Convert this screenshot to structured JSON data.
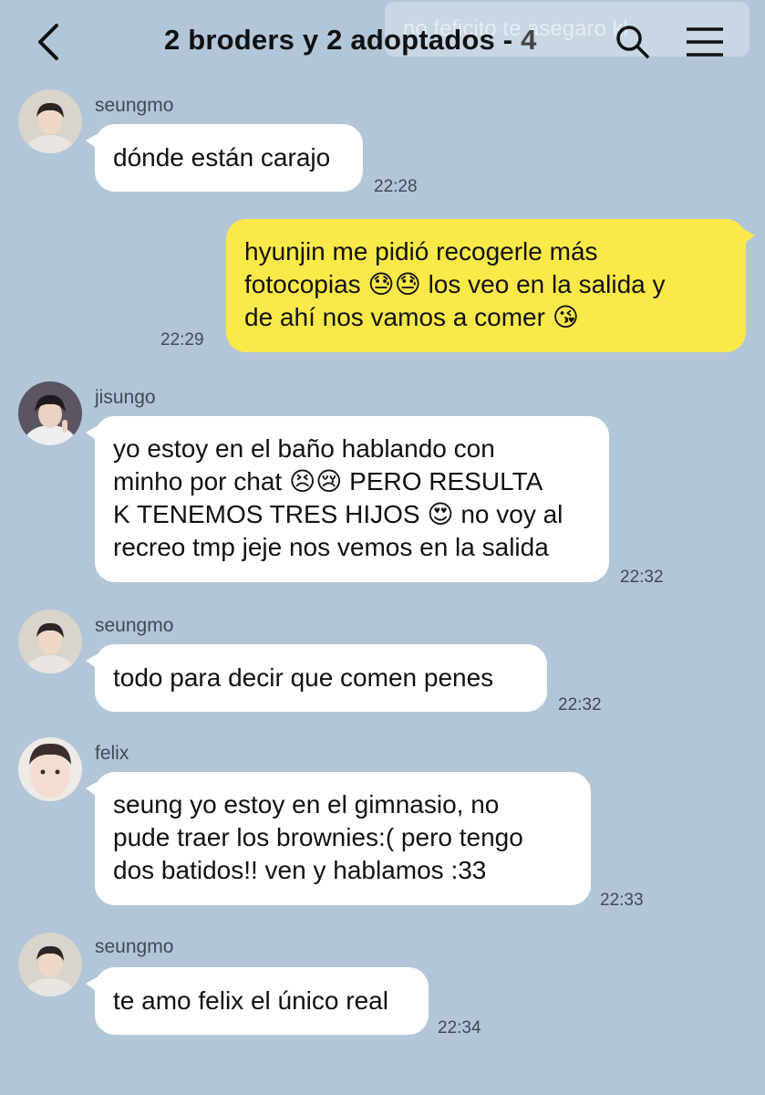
{
  "header": {
    "title": "2 broders y 2 adoptados - ",
    "member_count": "4",
    "ghost_text": "no feficito te asegaro kl",
    "icons": {
      "back": "back-arrow-icon",
      "search": "search-icon",
      "menu": "hamburger-menu-icon"
    }
  },
  "colors": {
    "background": "#b2c6d8",
    "incoming_bubble": "#ffffff",
    "outgoing_bubble": "#fbe94a"
  },
  "messages": [
    {
      "sender": "seungmo",
      "text": "dónde están carajo",
      "time": "22:28",
      "direction": "in"
    },
    {
      "sender": "",
      "text": "hyunjin me pidió recogerle más\nfotocopias 😓😓 los veo en la salida y\nde ahí nos vamos a comer 😘",
      "time": "22:29",
      "direction": "out"
    },
    {
      "sender": "jisungo",
      "text": "yo estoy en el baño hablando con\nminho por chat 😣😢 PERO RESULTA\nK TENEMOS TRES HIJOS 😍 no voy al\nrecreo tmp jeje nos vemos en la salida",
      "time": "22:32",
      "direction": "in"
    },
    {
      "sender": "seungmo",
      "text": "todo para decir que comen penes",
      "time": "22:32",
      "direction": "in"
    },
    {
      "sender": "felix",
      "text": "seung yo estoy en el gimnasio, no\npude traer los brownies:( pero tengo\ndos batidos!! ven y hablamos :33",
      "time": "22:33",
      "direction": "in"
    },
    {
      "sender": "seungmo",
      "text": "te amo felix el único real",
      "time": "22:34",
      "direction": "in"
    }
  ]
}
